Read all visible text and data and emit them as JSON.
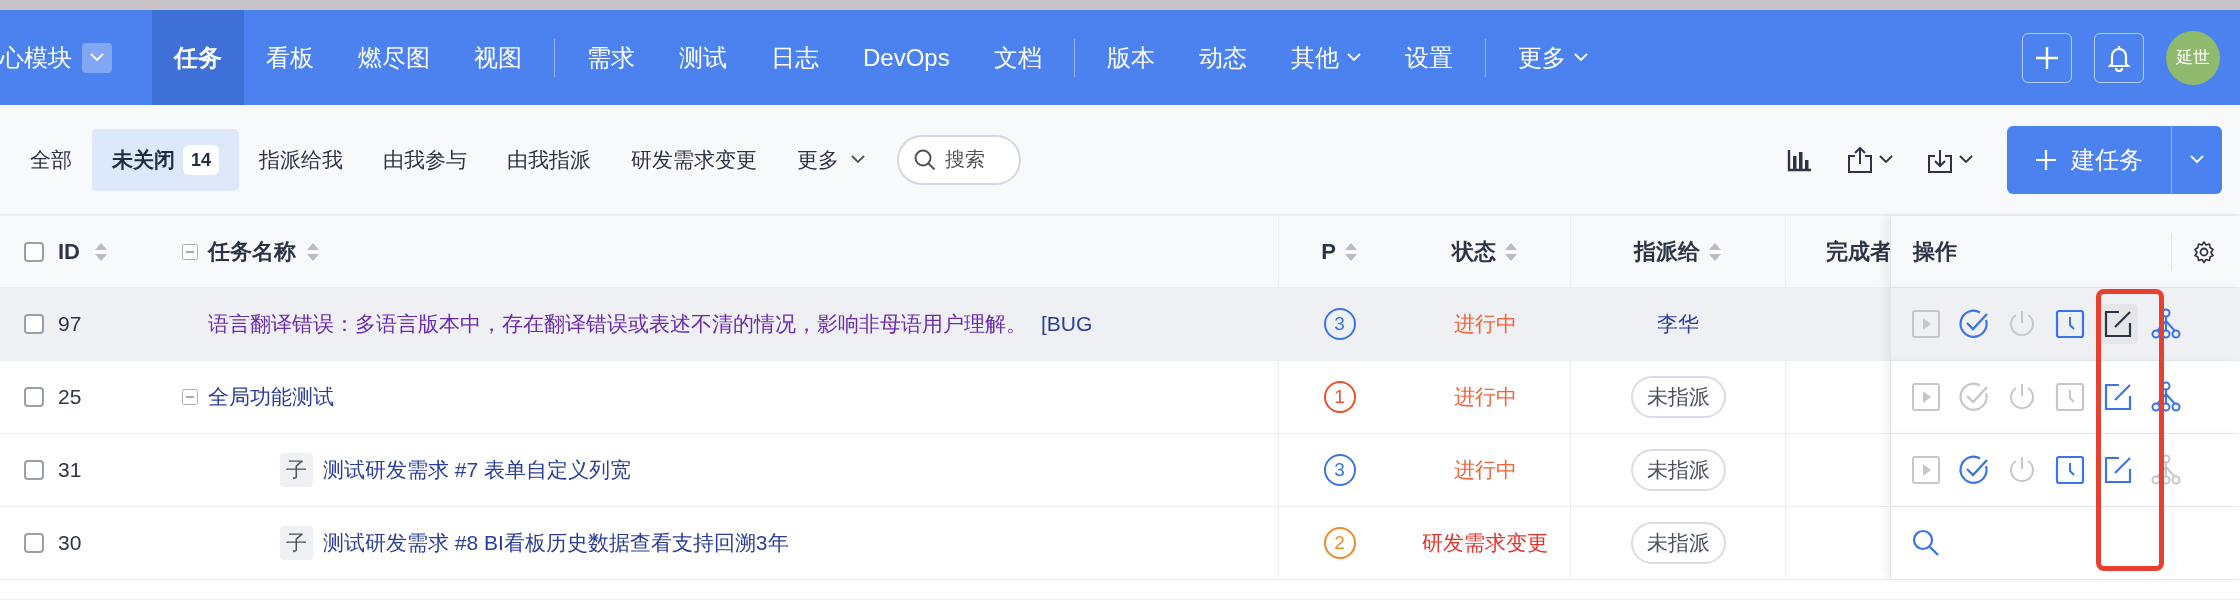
{
  "nav": {
    "project": "心模块",
    "groups": [
      [
        {
          "label": "任务",
          "selected": true,
          "dropdown": false
        },
        {
          "label": "看板",
          "selected": false,
          "dropdown": false
        },
        {
          "label": "燃尽图",
          "selected": false,
          "dropdown": false
        },
        {
          "label": "视图",
          "selected": false,
          "dropdown": false
        }
      ],
      [
        {
          "label": "需求",
          "selected": false,
          "dropdown": false
        },
        {
          "label": "测试",
          "selected": false,
          "dropdown": false
        },
        {
          "label": "日志",
          "selected": false,
          "dropdown": false
        },
        {
          "label": "DevOps",
          "selected": false,
          "dropdown": false
        },
        {
          "label": "文档",
          "selected": false,
          "dropdown": false
        }
      ],
      [
        {
          "label": "版本",
          "selected": false,
          "dropdown": false
        },
        {
          "label": "动态",
          "selected": false,
          "dropdown": false
        },
        {
          "label": "其他",
          "selected": false,
          "dropdown": true
        },
        {
          "label": "设置",
          "selected": false,
          "dropdown": false
        }
      ],
      [
        {
          "label": "更多",
          "selected": false,
          "dropdown": true
        }
      ]
    ],
    "avatar": "延世"
  },
  "filters": [
    {
      "label": "全部",
      "selected": false,
      "dropdown": false
    },
    {
      "label": "未关闭",
      "count": "14",
      "selected": true,
      "dropdown": false
    },
    {
      "label": "指派给我",
      "selected": false,
      "dropdown": false
    },
    {
      "label": "由我参与",
      "selected": false,
      "dropdown": false
    },
    {
      "label": "由我指派",
      "selected": false,
      "dropdown": false
    },
    {
      "label": "研发需求变更",
      "selected": false,
      "dropdown": false
    },
    {
      "label": "更多",
      "selected": false,
      "dropdown": true
    }
  ],
  "search": {
    "placeholder": "搜索"
  },
  "create_button": "建任务",
  "table": {
    "columns": [
      "ID",
      "任务名称",
      "P",
      "状态",
      "指派给",
      "完成者",
      "操作"
    ],
    "all_checked": false,
    "rows": [
      {
        "id": "97",
        "checked": false,
        "name": "语言翻译错误：多语言版本中，存在翻译错误或表述不清的情况，影响非母语用户理解。",
        "tag": "[BUG",
        "visited": true,
        "hovered": true,
        "priority": {
          "text": "3",
          "color": "#3b74e8"
        },
        "status": {
          "text": "进行中",
          "color": "#f0643c"
        },
        "assignee": {
          "kind": "user",
          "name": "李华"
        },
        "actions": [
          {
            "kind": "start",
            "enabled": false,
            "hovered": false
          },
          {
            "kind": "finish",
            "enabled": true,
            "hovered": false
          },
          {
            "kind": "close",
            "enabled": false,
            "hovered": false
          },
          {
            "kind": "log",
            "enabled": true,
            "hovered": false
          },
          {
            "kind": "edit",
            "enabled": true,
            "hovered": true
          },
          {
            "kind": "split",
            "enabled": true,
            "hovered": false
          }
        ]
      },
      {
        "id": "25",
        "checked": false,
        "name": "全局功能测试",
        "visited": false,
        "hovered": false,
        "expanded": true,
        "priority": {
          "text": "1",
          "color": "#f0502c"
        },
        "status": {
          "text": "进行中",
          "color": "#f0643c"
        },
        "assignee": {
          "kind": "unassigned",
          "name": "未指派"
        },
        "actions": [
          {
            "kind": "start",
            "enabled": false,
            "hovered": false
          },
          {
            "kind": "finish",
            "enabled": false,
            "hovered": false
          },
          {
            "kind": "close",
            "enabled": false,
            "hovered": false
          },
          {
            "kind": "log",
            "enabled": false,
            "hovered": false
          },
          {
            "kind": "edit",
            "enabled": true,
            "hovered": false
          },
          {
            "kind": "split",
            "enabled": true,
            "hovered": false
          }
        ],
        "children": [
          {
            "id": "31",
            "checked": false,
            "badge": "子",
            "name": "测试研发需求 #7 表单自定义列宽",
            "visited": false,
            "hovered": false,
            "priority": {
              "text": "3",
              "color": "#3b74e8"
            },
            "status": {
              "text": "进行中",
              "color": "#f0643c"
            },
            "assignee": {
              "kind": "unassigned",
              "name": "未指派"
            },
            "actions": [
              {
                "kind": "start",
                "enabled": false,
                "hovered": false
              },
              {
                "kind": "finish",
                "enabled": true,
                "hovered": false
              },
              {
                "kind": "close",
                "enabled": false,
                "hovered": false
              },
              {
                "kind": "log",
                "enabled": true,
                "hovered": false
              },
              {
                "kind": "edit",
                "enabled": true,
                "hovered": false
              },
              {
                "kind": "split",
                "enabled": false,
                "hovered": false
              }
            ]
          },
          {
            "id": "30",
            "checked": false,
            "badge": "子",
            "name": "测试研发需求 #8 BI看板历史数据查看支持回溯3年",
            "visited": false,
            "hovered": false,
            "priority": {
              "text": "2",
              "color": "#ee8a2a"
            },
            "status": {
              "text": "研发需求变更",
              "color": "#e8302a"
            },
            "assignee": {
              "kind": "unassigned",
              "name": "未指派"
            },
            "actions": [
              {
                "kind": "view",
                "enabled": true,
                "hovered": false
              }
            ]
          }
        ]
      }
    ]
  },
  "annotation": {
    "kind": "frame"
  }
}
